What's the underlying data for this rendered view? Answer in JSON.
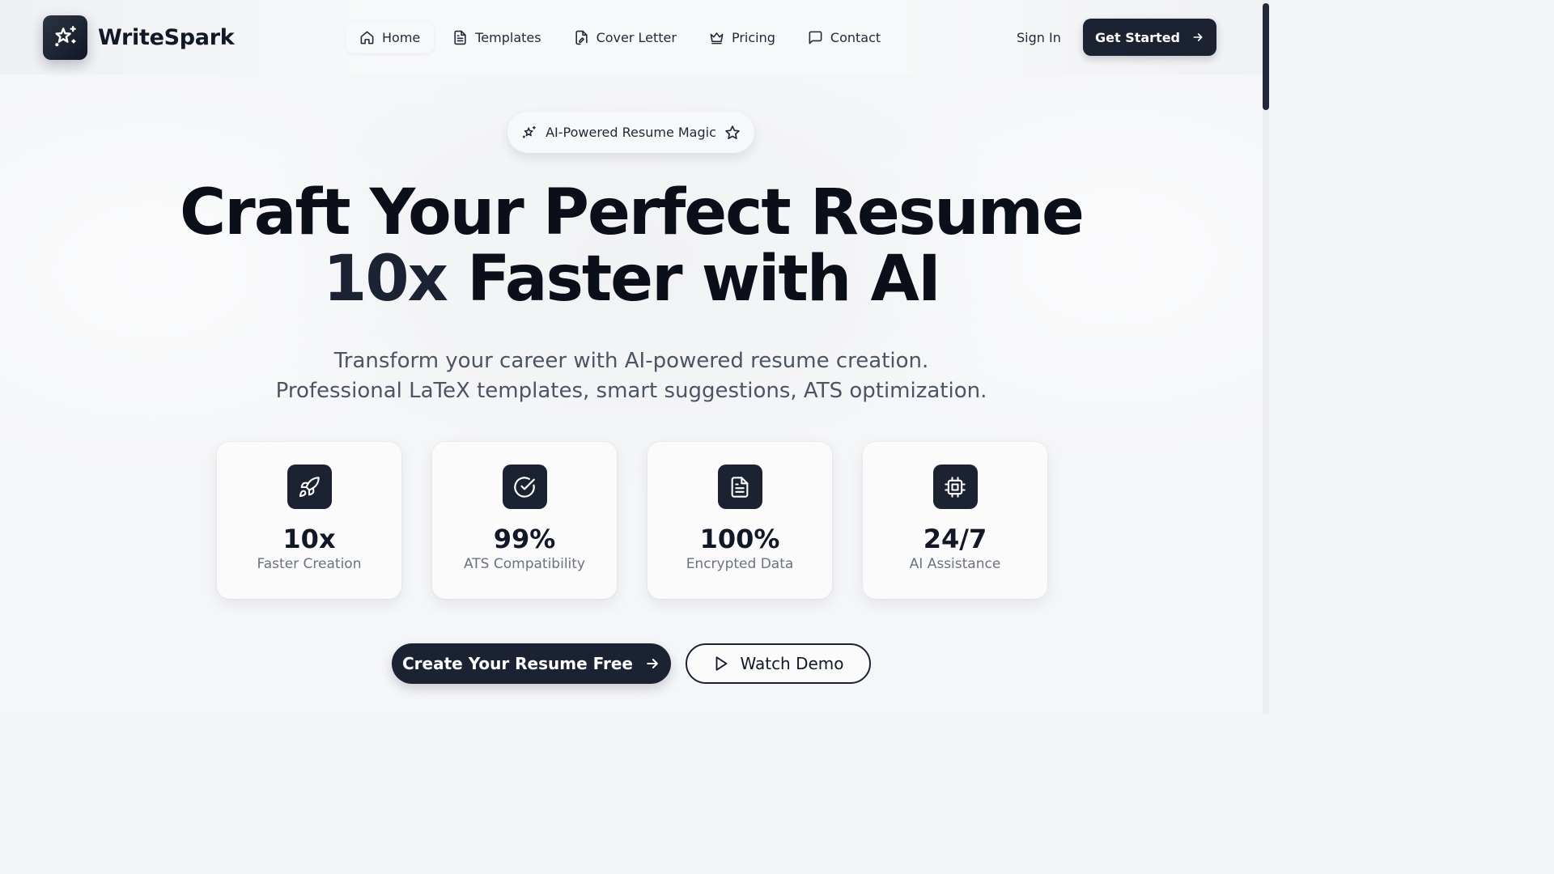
{
  "brand": {
    "name": "WriteSpark",
    "logo_icon": "sparkles-icon"
  },
  "nav": {
    "items": [
      {
        "label": "Home",
        "icon": "home-icon",
        "active": true
      },
      {
        "label": "Templates",
        "icon": "file-text-icon",
        "active": false
      },
      {
        "label": "Cover Letter",
        "icon": "file-signature-icon",
        "active": false
      },
      {
        "label": "Pricing",
        "icon": "crown-icon",
        "active": false
      },
      {
        "label": "Contact",
        "icon": "message-square-icon",
        "active": false
      }
    ],
    "sign_in": "Sign In",
    "get_started": "Get Started"
  },
  "hero": {
    "badge": "AI-Powered Resume Magic",
    "title_line1": "Craft Your Perfect Resume",
    "title_line2_accent": "10x",
    "title_line2_rest": " Faster with AI",
    "subtitle_line1": "Transform your career with AI-powered resume creation.",
    "subtitle_line2": "Professional LaTeX templates, smart suggestions, ATS optimization."
  },
  "stats": [
    {
      "value": "10x",
      "label": "Faster Creation",
      "icon": "rocket-icon"
    },
    {
      "value": "99%",
      "label": "ATS Compatibility",
      "icon": "check-circle-icon"
    },
    {
      "value": "100%",
      "label": "Encrypted Data",
      "icon": "file-text-icon"
    },
    {
      "value": "24/7",
      "label": "AI Assistance",
      "icon": "cpu-icon"
    }
  ],
  "cta": {
    "primary": "Create Your Resume Free",
    "secondary": "Watch Demo"
  },
  "colors": {
    "primary_dark": "#1b2232",
    "background": "#f5f6f8",
    "text_muted": "#6b7280"
  }
}
